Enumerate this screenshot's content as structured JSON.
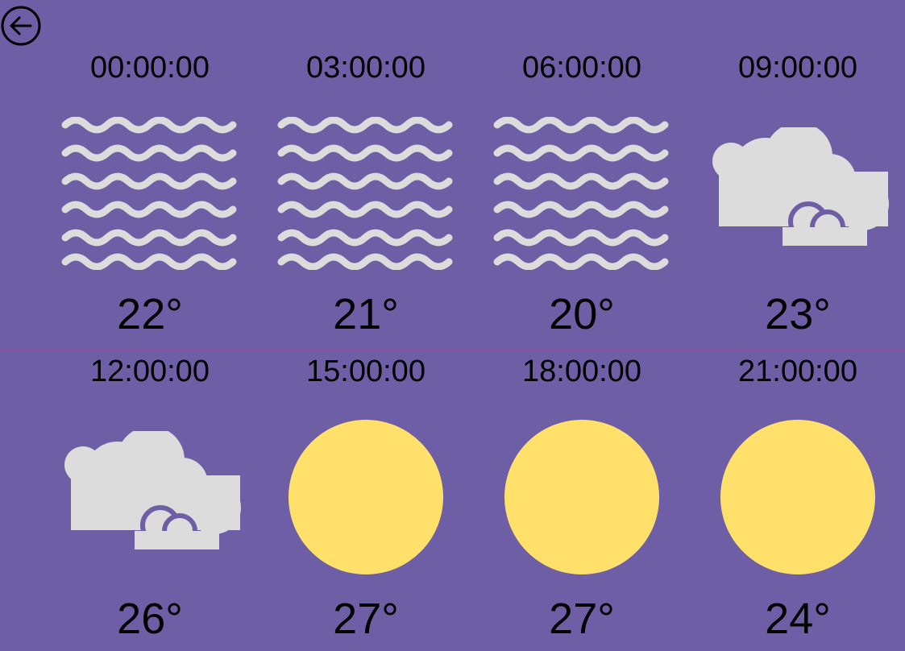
{
  "back": {
    "icon": "arrow-left-circle-icon"
  },
  "forecast": [
    {
      "time": "00:00:00",
      "temp": "22°",
      "icon": "fog-icon"
    },
    {
      "time": "03:00:00",
      "temp": "21°",
      "icon": "fog-icon"
    },
    {
      "time": "06:00:00",
      "temp": "20°",
      "icon": "fog-icon"
    },
    {
      "time": "09:00:00",
      "temp": "23°",
      "icon": "clouds-icon"
    },
    {
      "time": "12:00:00",
      "temp": "26°",
      "icon": "clouds-icon"
    },
    {
      "time": "15:00:00",
      "temp": "27°",
      "icon": "sun-icon"
    },
    {
      "time": "18:00:00",
      "temp": "27°",
      "icon": "sun-icon"
    },
    {
      "time": "21:00:00",
      "temp": "24°",
      "icon": "sun-icon"
    }
  ],
  "colors": {
    "background": "#6e5ea5",
    "icon_gray": "#dcdcdc",
    "sun": "#ffe06b",
    "text": "#000000"
  }
}
